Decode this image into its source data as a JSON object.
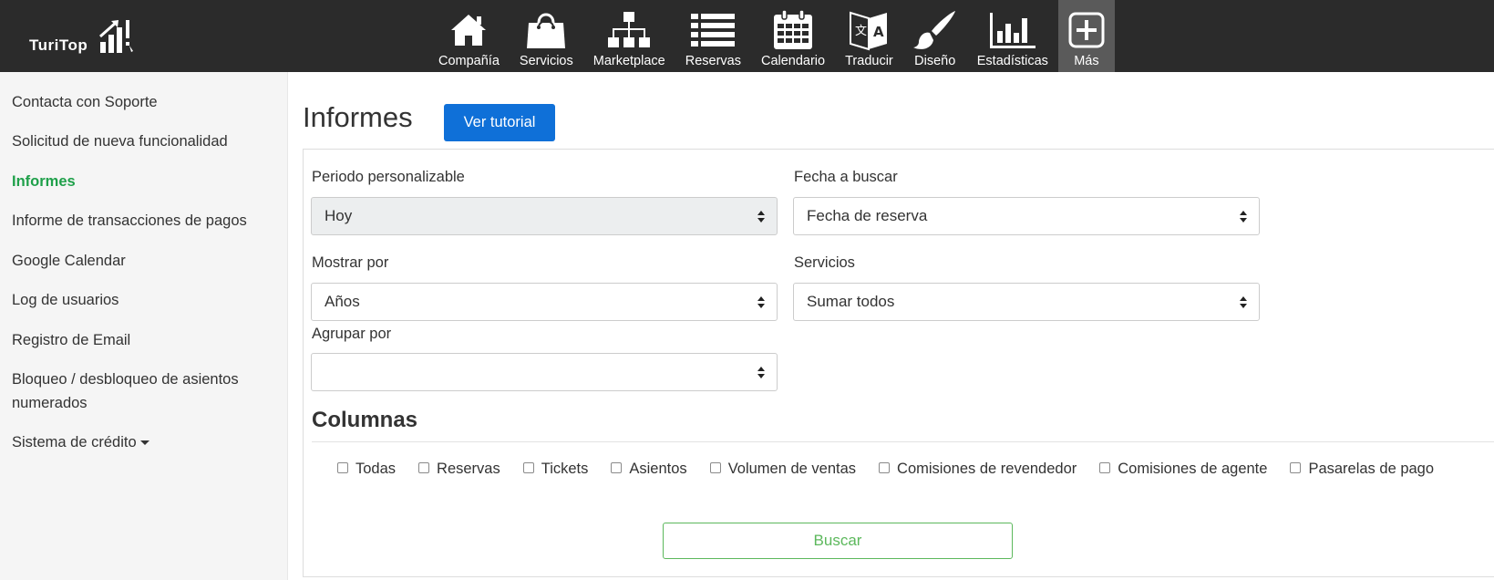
{
  "app": {
    "logo_text": "TuriTop"
  },
  "nav": {
    "items": [
      {
        "label": "Compañía",
        "icon": "home-icon"
      },
      {
        "label": "Servicios",
        "icon": "shopping-bag-icon"
      },
      {
        "label": "Marketplace",
        "icon": "sitemap-icon"
      },
      {
        "label": "Reservas",
        "icon": "list-icon"
      },
      {
        "label": "Calendario",
        "icon": "calendar-icon"
      },
      {
        "label": "Traducir",
        "icon": "translate-icon"
      },
      {
        "label": "Diseño",
        "icon": "paintbrush-icon"
      },
      {
        "label": "Estadísticas",
        "icon": "bar-chart-icon"
      },
      {
        "label": "Más",
        "icon": "plus-square-icon"
      }
    ],
    "active": "Más"
  },
  "sidebar": {
    "items": [
      {
        "label": "Contacta con Soporte"
      },
      {
        "label": "Solicitud de nueva funcionalidad"
      },
      {
        "label": "Informes"
      },
      {
        "label": "Informe de transacciones de pagos"
      },
      {
        "label": "Google Calendar"
      },
      {
        "label": "Log de usuarios"
      },
      {
        "label": "Registro de Email"
      },
      {
        "label": "Bloqueo / desbloqueo de asientos numerados"
      },
      {
        "label": "Sistema de crédito"
      }
    ],
    "active": "Informes"
  },
  "main": {
    "title": "Informes",
    "tutorial_button": "Ver tutorial",
    "fields": {
      "periodo": {
        "label": "Periodo personalizable",
        "value": "Hoy"
      },
      "fecha": {
        "label": "Fecha a buscar",
        "value": "Fecha de reserva"
      },
      "mostrar": {
        "label": "Mostrar por",
        "value": "Años"
      },
      "servicios": {
        "label": "Servicios",
        "value": "Sumar todos"
      },
      "agrupar": {
        "label": "Agrupar por",
        "value": ""
      }
    },
    "columns_title": "Columnas",
    "columns": [
      {
        "label": "Todas",
        "checked": false
      },
      {
        "label": "Reservas",
        "checked": false
      },
      {
        "label": "Tickets",
        "checked": false
      },
      {
        "label": "Asientos",
        "checked": false
      },
      {
        "label": "Volumen de ventas",
        "checked": false
      },
      {
        "label": "Comisiones de revendedor",
        "checked": false
      },
      {
        "label": "Comisiones de agente",
        "checked": false
      },
      {
        "label": "Pasarelas de pago",
        "checked": false
      }
    ],
    "search_button": "Buscar"
  },
  "colors": {
    "topbar": "#2b2b2b",
    "active_nav": "#5a5a5a",
    "primary": "#0f70d8",
    "active_sidebar": "#1fa04a",
    "search_border": "#5cb85c"
  }
}
